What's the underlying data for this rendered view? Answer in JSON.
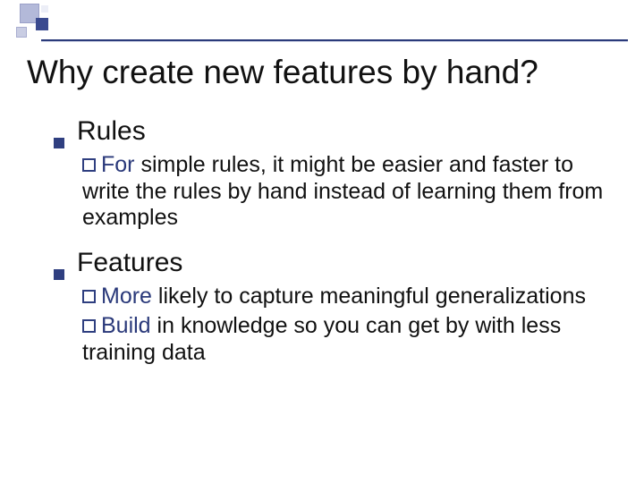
{
  "title": "Why create new features by hand?",
  "items": [
    {
      "label": "Rules",
      "sub": [
        {
          "lead": "For",
          "rest": " simple rules, it might be easier and faster to write the rules by hand instead of learning them from examples"
        }
      ]
    },
    {
      "label": "Features",
      "sub": [
        {
          "lead": "More",
          "rest": " likely to capture meaningful generalizations"
        },
        {
          "lead": "Build",
          "rest": " in knowledge so you can get by with less training data"
        }
      ]
    }
  ]
}
